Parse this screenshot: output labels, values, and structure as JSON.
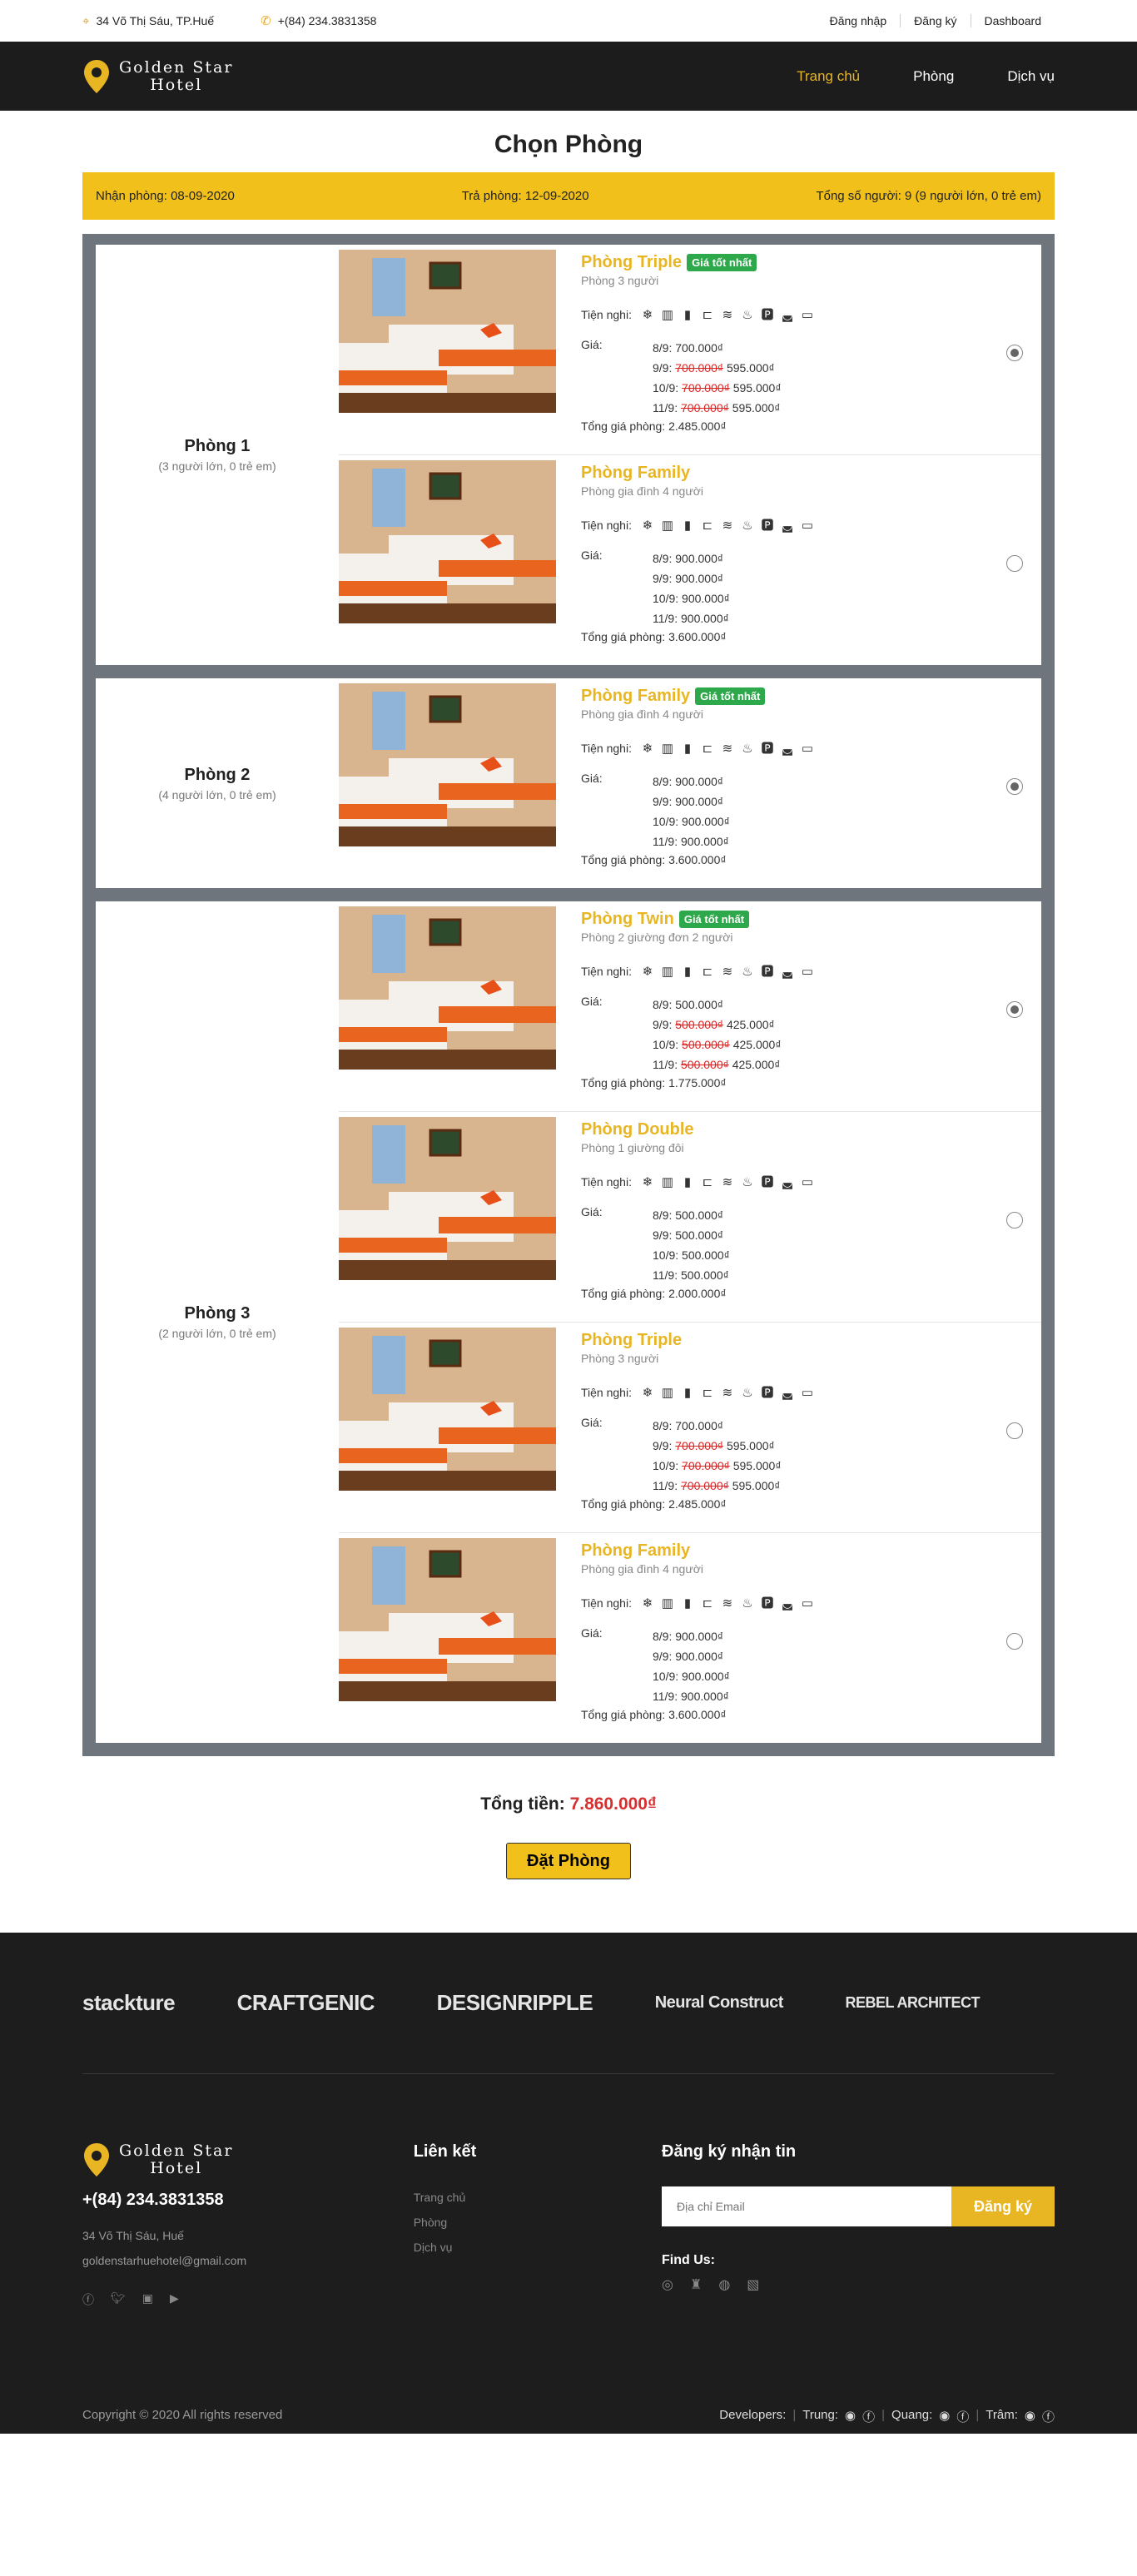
{
  "topbar": {
    "address": "34 Võ Thị Sáu, TP.Huế",
    "phone": "+(84) 234.3831358",
    "links": [
      "Đăng nhập",
      "Đăng ký",
      "Dashboard"
    ]
  },
  "brand": {
    "line1": "Golden Star",
    "line2": "Hotel"
  },
  "nav": {
    "items": [
      "Trang chủ",
      "Phòng",
      "Dịch vụ"
    ],
    "active": 0
  },
  "page": {
    "title": "Chọn Phòng"
  },
  "info": {
    "checkin": "Nhận phòng: 08-09-2020",
    "checkout": "Trả phòng: 12-09-2020",
    "guests": "Tổng số người: 9 (9 người lớn, 0 trẻ em)"
  },
  "labels": {
    "amenities": "Tiện nghi:",
    "price": "Giá:",
    "best": "Giá tốt nhất",
    "total_prefix": "Tổng giá phòng:"
  },
  "groups": [
    {
      "name": "Phòng 1",
      "sub": "(3 người lớn, 0 trẻ em)",
      "options": [
        {
          "name": "Phòng Triple",
          "best": true,
          "desc": "Phòng 3 người",
          "checked": true,
          "prices": [
            {
              "day": "8/9:",
              "old": "",
              "price": "700.000₫"
            },
            {
              "day": "9/9:",
              "old": "700.000₫",
              "price": "595.000₫"
            },
            {
              "day": "10/9:",
              "old": "700.000₫",
              "price": "595.000₫"
            },
            {
              "day": "11/9:",
              "old": "700.000₫",
              "price": "595.000₫"
            }
          ],
          "total": "Tổng giá phòng: 2.485.000₫"
        },
        {
          "name": "Phòng Family",
          "best": false,
          "desc": "Phòng gia đình 4 người",
          "checked": false,
          "prices": [
            {
              "day": "8/9:",
              "old": "",
              "price": "900.000₫"
            },
            {
              "day": "9/9:",
              "old": "",
              "price": "900.000₫"
            },
            {
              "day": "10/9:",
              "old": "",
              "price": "900.000₫"
            },
            {
              "day": "11/9:",
              "old": "",
              "price": "900.000₫"
            }
          ],
          "total": "Tổng giá phòng: 3.600.000₫"
        }
      ]
    },
    {
      "name": "Phòng 2",
      "sub": "(4 người lớn, 0 trẻ em)",
      "options": [
        {
          "name": "Phòng Family",
          "best": true,
          "desc": "Phòng gia đình 4 người",
          "checked": true,
          "prices": [
            {
              "day": "8/9:",
              "old": "",
              "price": "900.000₫"
            },
            {
              "day": "9/9:",
              "old": "",
              "price": "900.000₫"
            },
            {
              "day": "10/9:",
              "old": "",
              "price": "900.000₫"
            },
            {
              "day": "11/9:",
              "old": "",
              "price": "900.000₫"
            }
          ],
          "total": "Tổng giá phòng: 3.600.000₫"
        }
      ]
    },
    {
      "name": "Phòng 3",
      "sub": "(2 người lớn, 0 trẻ em)",
      "options": [
        {
          "name": "Phòng Twin",
          "best": true,
          "desc": "Phòng 2 giường đơn 2 người",
          "checked": true,
          "prices": [
            {
              "day": "8/9:",
              "old": "",
              "price": "500.000₫"
            },
            {
              "day": "9/9:",
              "old": "500.000₫",
              "price": "425.000₫"
            },
            {
              "day": "10/9:",
              "old": "500.000₫",
              "price": "425.000₫"
            },
            {
              "day": "11/9:",
              "old": "500.000₫",
              "price": "425.000₫"
            }
          ],
          "total": "Tổng giá phòng: 1.775.000₫"
        },
        {
          "name": "Phòng Double",
          "best": false,
          "desc": "Phòng 1 giường đôi",
          "checked": false,
          "prices": [
            {
              "day": "8/9:",
              "old": "",
              "price": "500.000₫"
            },
            {
              "day": "9/9:",
              "old": "",
              "price": "500.000₫"
            },
            {
              "day": "10/9:",
              "old": "",
              "price": "500.000₫"
            },
            {
              "day": "11/9:",
              "old": "",
              "price": "500.000₫"
            }
          ],
          "total": "Tổng giá phòng: 2.000.000₫"
        },
        {
          "name": "Phòng Triple",
          "best": false,
          "desc": "Phòng 3 người",
          "checked": false,
          "prices": [
            {
              "day": "8/9:",
              "old": "",
              "price": "700.000₫"
            },
            {
              "day": "9/9:",
              "old": "700.000₫",
              "price": "595.000₫"
            },
            {
              "day": "10/9:",
              "old": "700.000₫",
              "price": "595.000₫"
            },
            {
              "day": "11/9:",
              "old": "700.000₫",
              "price": "595.000₫"
            }
          ],
          "total": "Tổng giá phòng: 2.485.000₫"
        },
        {
          "name": "Phòng Family",
          "best": false,
          "desc": "Phòng gia đình 4 người",
          "checked": false,
          "prices": [
            {
              "day": "8/9:",
              "old": "",
              "price": "900.000₫"
            },
            {
              "day": "9/9:",
              "old": "",
              "price": "900.000₫"
            },
            {
              "day": "10/9:",
              "old": "",
              "price": "900.000₫"
            },
            {
              "day": "11/9:",
              "old": "",
              "price": "900.000₫"
            }
          ],
          "total": "Tổng giá phòng: 3.600.000₫"
        }
      ]
    }
  ],
  "summary": {
    "label": "Tổng tiền:",
    "amount": "7.860.000₫",
    "button": "Đặt Phòng"
  },
  "footer": {
    "brands": [
      "stackture",
      "CRAFTGENIC",
      "DESIGNRIPPLE",
      "Neural Construct",
      "REBEL ARCHITECT"
    ],
    "phone": "+(84) 234.3831358",
    "address": "34 Võ Thị Sáu, Huế",
    "email": "goldenstarhuehotel@gmail.com",
    "links_title": "Liên kết",
    "links": [
      "Trang chủ",
      "Phòng",
      "Dịch vụ"
    ],
    "newsletter_title": "Đăng ký nhận tin",
    "email_placeholder": "Địa chỉ Email",
    "subscribe": "Đăng ký",
    "find_us": "Find Us:",
    "copyright": "Copyright © 2020 All rights reserved",
    "developers_label": "Developers:",
    "developers": [
      "Trung:",
      "Quang:",
      "Trâm:"
    ]
  },
  "colors": {
    "accent": "#e8b523",
    "best_badge": "#2da84a",
    "strike": "#dd2222",
    "panel": "#6e757c"
  }
}
